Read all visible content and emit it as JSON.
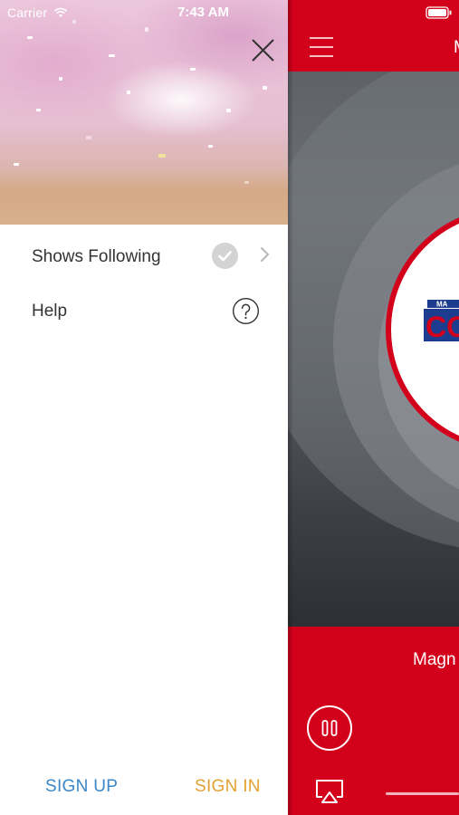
{
  "status_bar": {
    "carrier": "Carrier",
    "time": "7:43 AM"
  },
  "drawer": {
    "menu_items": [
      {
        "label": "Shows Following",
        "icon": "checkmark-circle-icon"
      },
      {
        "label": "Help",
        "icon": "question-circle-icon"
      }
    ],
    "sign_up_label": "SIGN UP",
    "sign_in_label": "SIGN IN"
  },
  "player": {
    "title_peek": "M",
    "station_name_peek": "Magn",
    "logo_text_top": "MA",
    "logo_text_main": "CO"
  },
  "colors": {
    "brand_red": "#d2001a",
    "sign_up": "#3a86c8",
    "sign_in": "#e3a133"
  }
}
